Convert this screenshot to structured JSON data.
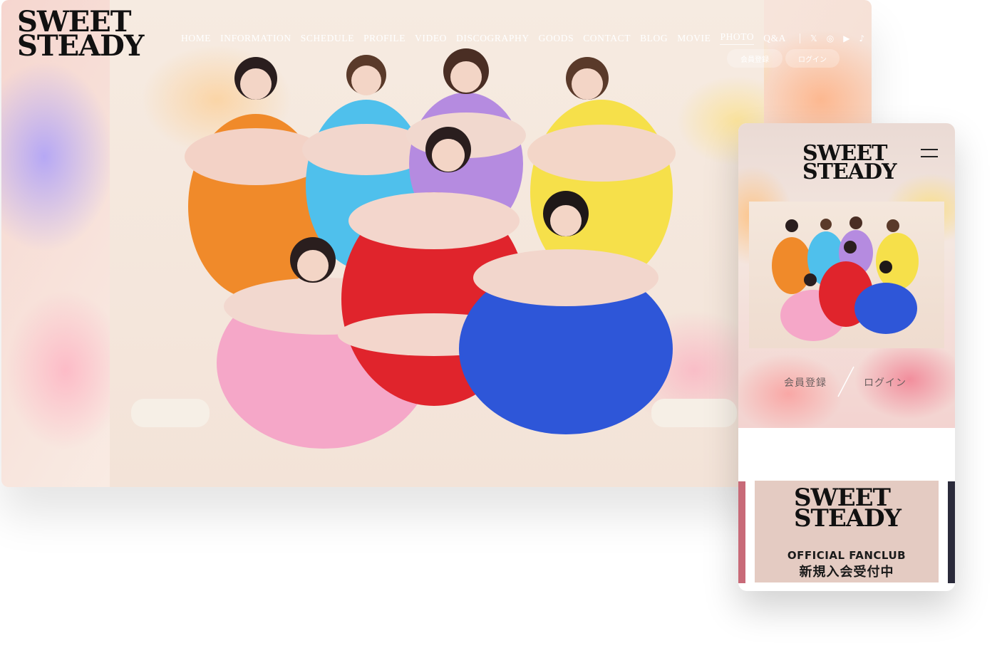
{
  "site": {
    "logo_line1": "SWEET",
    "logo_line2": "STEADY"
  },
  "nav": {
    "items": [
      {
        "label": "HOME"
      },
      {
        "label": "INFORMATION"
      },
      {
        "label": "SCHEDULE"
      },
      {
        "label": "PROFILE"
      },
      {
        "label": "VIDEO"
      },
      {
        "label": "DISCOGRAPHY"
      },
      {
        "label": "GOODS"
      },
      {
        "label": "CONTACT"
      },
      {
        "label": "BLOG"
      },
      {
        "label": "MOVIE"
      },
      {
        "label": "PHOTO"
      },
      {
        "label": "Q&A"
      }
    ],
    "active": "PHOTO",
    "social": [
      "x-icon",
      "instagram-icon",
      "youtube-icon",
      "tiktok-icon"
    ]
  },
  "auth": {
    "register_label": "会員登録",
    "login_label": "ログイン"
  },
  "mobile": {
    "register_label": "会員登録",
    "login_label": "ログイン",
    "divider": "/",
    "banner": {
      "logo_line1": "SWEET",
      "logo_line2": "STEADY",
      "line1": "OFFICIAL FANCLUB",
      "line2": "新規入会受付中"
    }
  },
  "colors": {
    "accent_pink": "#c86a78",
    "banner_bg": "#e4cbc2",
    "dark_side": "#2a2a3a"
  }
}
